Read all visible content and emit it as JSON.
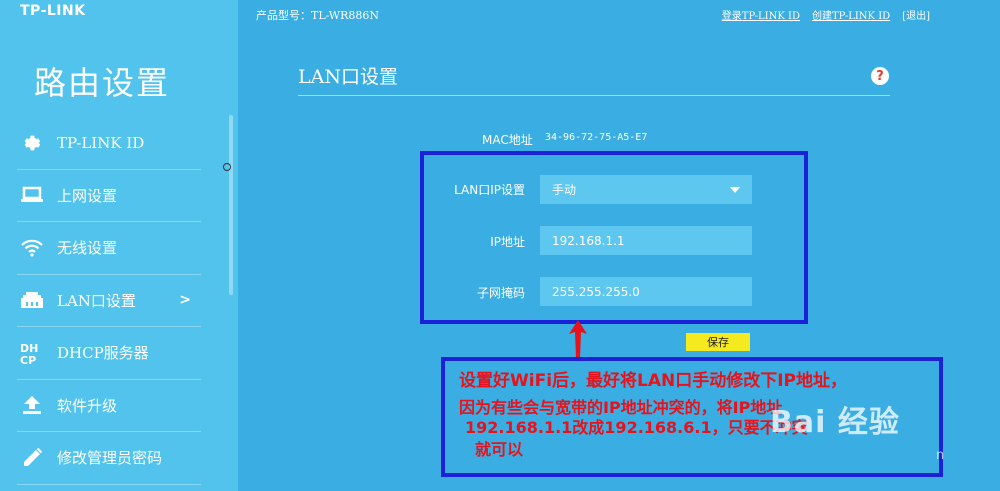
{
  "brand": "TP-LINK",
  "header": {
    "model": "产品型号：TL-WR886N",
    "links": [
      "登录TP-LINK ID",
      "创建TP-LINK ID"
    ],
    "logout": "[退出]"
  },
  "sidebar": {
    "title": "路由设置",
    "items": [
      {
        "label": "TP-LINK ID",
        "icon": "gear-icon"
      },
      {
        "label": "上网设置",
        "icon": "laptop-icon"
      },
      {
        "label": "无线设置",
        "icon": "wifi-icon"
      },
      {
        "label": "LAN口设置",
        "icon": "lan-port-icon",
        "active": true,
        "arrow": ">"
      },
      {
        "label": "DHCP服务器",
        "icon": "dhcp-icon"
      },
      {
        "label": "软件升级",
        "icon": "upload-icon"
      },
      {
        "label": "修改管理员密码",
        "icon": "pencil-icon"
      }
    ]
  },
  "main": {
    "title": "LAN口设置",
    "help": "?",
    "mac_label": "MAC地址",
    "mac_value": "34-96-72-75-A5-E7",
    "lan_ip_setting_label": "LAN口IP设置",
    "lan_ip_setting_value": "手动",
    "ip_label": "IP地址",
    "ip_value": "192.168.1.1",
    "mask_label": "子网掩码",
    "mask_value": "255.255.255.0",
    "save": "保存"
  },
  "annotation": {
    "line1": "设置好WiFi后，最好将LAN口手动修改下IP地址，",
    "line2": "因为有些会与宽带的IP地址冲突的，将IP地址",
    "line3": "192.168.1.1改成192.168.6.1，只要不冲突",
    "line4": "就可以"
  },
  "watermark": {
    "text": "Bai 经验",
    "sub": "n"
  },
  "colors": {
    "background": "#3aaee2",
    "sidebar": "#52c3ec",
    "annotation": "#e8121c",
    "box": "#1a21d6",
    "save": "#f5ea1f"
  }
}
